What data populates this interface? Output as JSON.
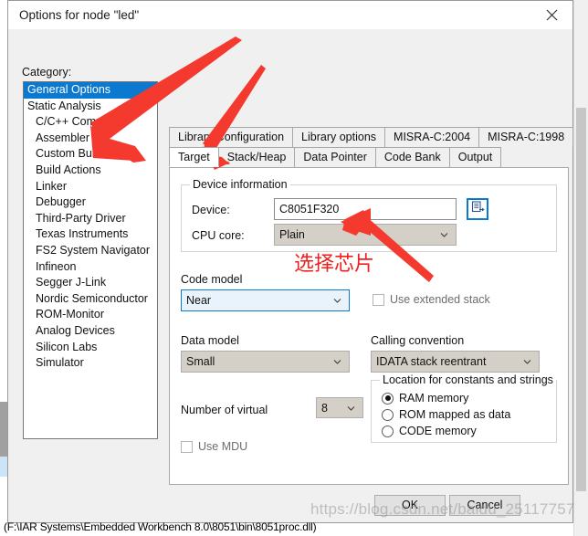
{
  "window": {
    "title": "Options for node \"led\"",
    "close_icon": "close-icon"
  },
  "category": {
    "label": "Category:",
    "items": [
      {
        "label": "General Options",
        "indent": 0,
        "selected": true
      },
      {
        "label": "Static Analysis",
        "indent": 0,
        "selected": false
      },
      {
        "label": "C/C++ Compiler",
        "indent": 1,
        "selected": false
      },
      {
        "label": "Assembler",
        "indent": 1,
        "selected": false
      },
      {
        "label": "Custom Build",
        "indent": 1,
        "selected": false
      },
      {
        "label": "Build Actions",
        "indent": 1,
        "selected": false
      },
      {
        "label": "Linker",
        "indent": 1,
        "selected": false
      },
      {
        "label": "Debugger",
        "indent": 1,
        "selected": false
      },
      {
        "label": "Third-Party Driver",
        "indent": 2,
        "selected": false
      },
      {
        "label": "Texas Instruments",
        "indent": 2,
        "selected": false
      },
      {
        "label": "FS2 System Navigator",
        "indent": 2,
        "selected": false
      },
      {
        "label": "Infineon",
        "indent": 2,
        "selected": false
      },
      {
        "label": "Segger J-Link",
        "indent": 2,
        "selected": false
      },
      {
        "label": "Nordic Semiconductor",
        "indent": 2,
        "selected": false
      },
      {
        "label": "ROM-Monitor",
        "indent": 2,
        "selected": false
      },
      {
        "label": "Analog Devices",
        "indent": 2,
        "selected": false
      },
      {
        "label": "Silicon Labs",
        "indent": 2,
        "selected": false
      },
      {
        "label": "Simulator",
        "indent": 2,
        "selected": false
      }
    ]
  },
  "tabs": {
    "row1": [
      {
        "label": "Library Configuration",
        "selected": false
      },
      {
        "label": "Library options",
        "selected": false
      },
      {
        "label": "MISRA-C:2004",
        "selected": false
      },
      {
        "label": "MISRA-C:1998",
        "selected": false
      }
    ],
    "row2": [
      {
        "label": "Target",
        "selected": true
      },
      {
        "label": "Stack/Heap",
        "selected": false
      },
      {
        "label": "Data Pointer",
        "selected": false
      },
      {
        "label": "Code Bank",
        "selected": false
      },
      {
        "label": "Output",
        "selected": false
      }
    ]
  },
  "target_page": {
    "device_group": {
      "legend": "Device information",
      "device_label": "Device:",
      "device_value": "C8051F320",
      "device_picker_icon": "device-picker-icon",
      "cpu_core_label": "CPU core:",
      "cpu_core_value": "Plain"
    },
    "code_model": {
      "label": "Code model",
      "value": "Near"
    },
    "use_extended_stack": {
      "label": "Use extended stack",
      "checked": false,
      "enabled": false
    },
    "data_model": {
      "label": "Data model",
      "value": "Small"
    },
    "calling_convention": {
      "label": "Calling convention",
      "value": "IDATA stack reentrant"
    },
    "number_of_virtual": {
      "label": "Number of virtual",
      "value": "8"
    },
    "use_mdu": {
      "label": "Use MDU",
      "checked": false,
      "enabled": false
    },
    "location_group": {
      "legend": "Location for constants and strings",
      "options": [
        {
          "label": "RAM memory",
          "selected": true
        },
        {
          "label": "ROM mapped as data",
          "selected": false
        },
        {
          "label": "CODE memory",
          "selected": false
        }
      ]
    }
  },
  "footer": {
    "ok_label": "OK",
    "cancel_label": "Cancel"
  },
  "status_line": "(F:\\IAR Systems\\Embedded Workbench 8.0\\8051\\bin\\8051proc.dll)",
  "watermark": "https://blog.csdn.net/baidu_25117757",
  "annotations": {
    "chinese_note": "选择芯片",
    "arrow_color": "#f4392f"
  },
  "colors": {
    "selection_blue": "#0b79d0",
    "dialog_bg": "#f0f0f0",
    "annotation_red": "#f4392f"
  }
}
